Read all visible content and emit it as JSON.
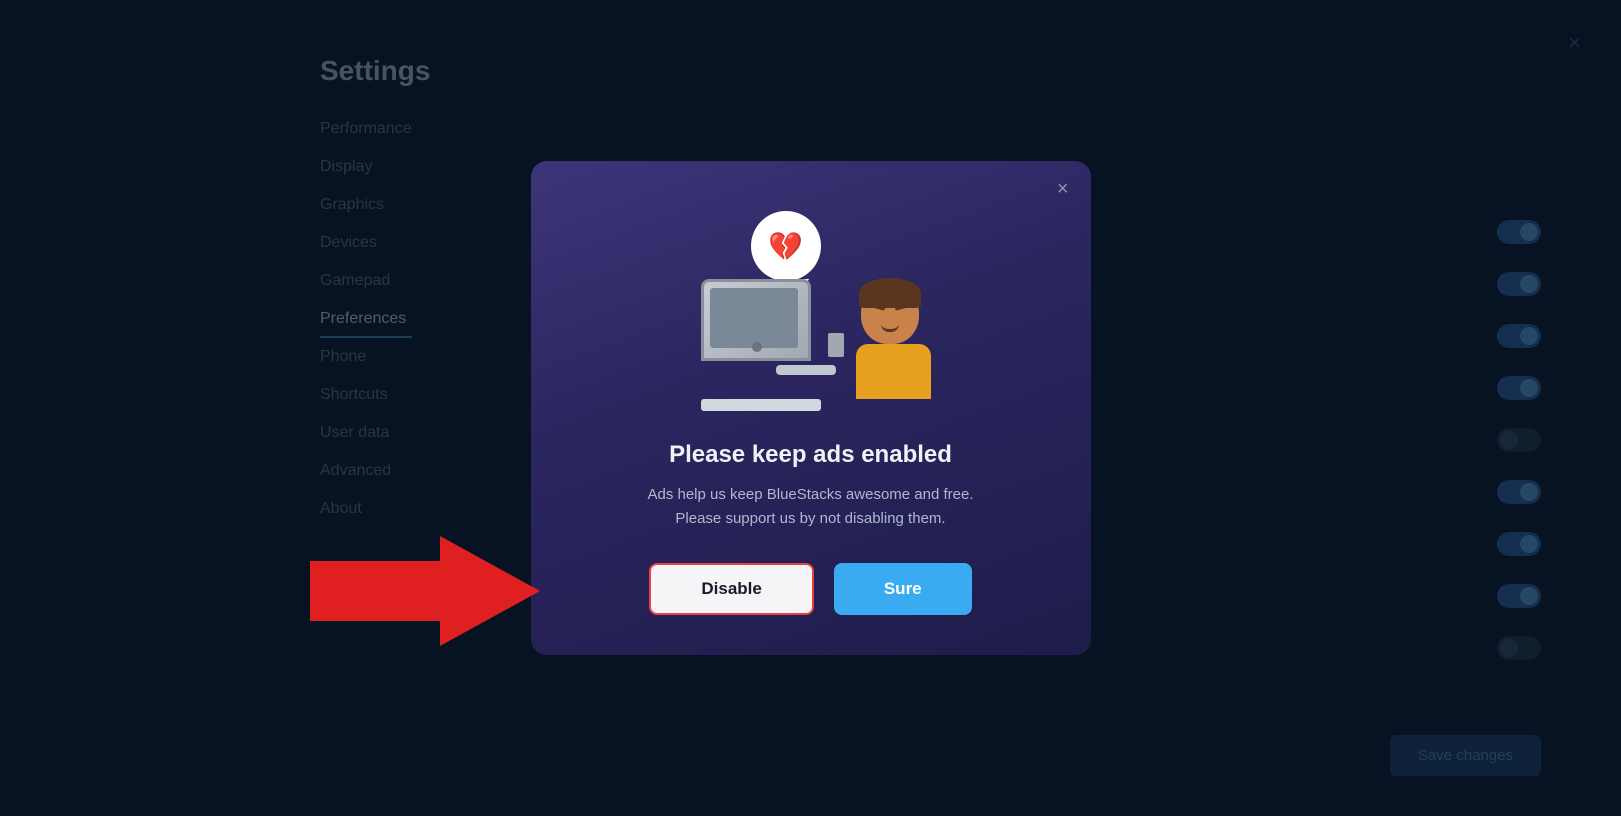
{
  "settings": {
    "title": "Settings",
    "close_label": "×",
    "nav_items": [
      {
        "id": "performance",
        "label": "Performance",
        "active": false
      },
      {
        "id": "display",
        "label": "Display",
        "active": false
      },
      {
        "id": "graphics",
        "label": "Graphics",
        "active": false
      },
      {
        "id": "devices",
        "label": "Devices",
        "active": false
      },
      {
        "id": "gamepad",
        "label": "Gamepad",
        "active": false
      },
      {
        "id": "preferences",
        "label": "Preferences",
        "active": true
      },
      {
        "id": "phone",
        "label": "Phone",
        "active": false
      },
      {
        "id": "shortcuts",
        "label": "Shortcuts",
        "active": false
      },
      {
        "id": "userdata",
        "label": "User data",
        "active": false
      },
      {
        "id": "advanced",
        "label": "Advanced",
        "active": false
      },
      {
        "id": "about",
        "label": "About",
        "active": false
      }
    ],
    "save_button_label": "Save changes"
  },
  "modal": {
    "close_label": "×",
    "title": "Please keep ads enabled",
    "description": "Ads help us keep BlueStacks awesome and free.\nPlease support us by not disabling them.",
    "disable_button_label": "Disable",
    "sure_button_label": "Sure",
    "illustration_emoji": "💔"
  },
  "toggles": [
    {
      "id": "t1",
      "state": "on"
    },
    {
      "id": "t2",
      "state": "on"
    },
    {
      "id": "t3",
      "state": "on"
    },
    {
      "id": "t4",
      "state": "on"
    },
    {
      "id": "t5",
      "state": "off"
    },
    {
      "id": "t6",
      "state": "on"
    },
    {
      "id": "t7",
      "state": "on"
    },
    {
      "id": "t8",
      "state": "on"
    },
    {
      "id": "t9",
      "state": "off"
    }
  ]
}
